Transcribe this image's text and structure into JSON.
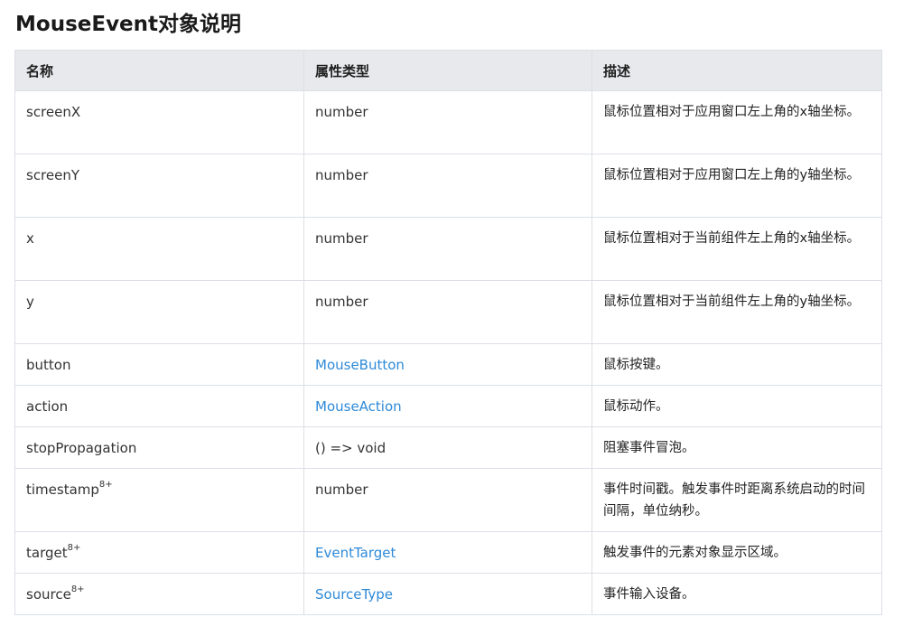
{
  "page": {
    "title": "MouseEvent对象说明"
  },
  "table": {
    "headers": [
      "名称",
      "属性类型",
      "描述"
    ],
    "rows": [
      {
        "name": "screenX",
        "sup": "",
        "type": "number",
        "type_is_link": false,
        "desc": "鼠标位置相对于应用窗口左上角的x轴坐标。"
      },
      {
        "name": "screenY",
        "sup": "",
        "type": "number",
        "type_is_link": false,
        "desc": "鼠标位置相对于应用窗口左上角的y轴坐标。"
      },
      {
        "name": "x",
        "sup": "",
        "type": "number",
        "type_is_link": false,
        "desc": "鼠标位置相对于当前组件左上角的x轴坐标。"
      },
      {
        "name": "y",
        "sup": "",
        "type": "number",
        "type_is_link": false,
        "desc": "鼠标位置相对于当前组件左上角的y轴坐标。"
      },
      {
        "name": "button",
        "sup": "",
        "type": "MouseButton",
        "type_is_link": true,
        "desc": "鼠标按键。"
      },
      {
        "name": "action",
        "sup": "",
        "type": "MouseAction",
        "type_is_link": true,
        "desc": "鼠标动作。"
      },
      {
        "name": "stopPropagation",
        "sup": "",
        "type": "() => void",
        "type_is_link": false,
        "desc": "阻塞事件冒泡。"
      },
      {
        "name": "timestamp",
        "sup": "8+",
        "type": "number",
        "type_is_link": false,
        "desc": "事件时间戳。触发事件时距离系统启动的时间间隔，单位纳秒。"
      },
      {
        "name": "target",
        "sup": "8+",
        "type": "EventTarget",
        "type_is_link": true,
        "desc": "触发事件的元素对象显示区域。"
      },
      {
        "name": "source",
        "sup": "8+",
        "type": "SourceType",
        "type_is_link": true,
        "desc": "事件输入设备。"
      }
    ]
  },
  "colors": {
    "header_bg": "#e8e9ed",
    "border": "#dcdfe6",
    "link": "#2e8ad8"
  }
}
